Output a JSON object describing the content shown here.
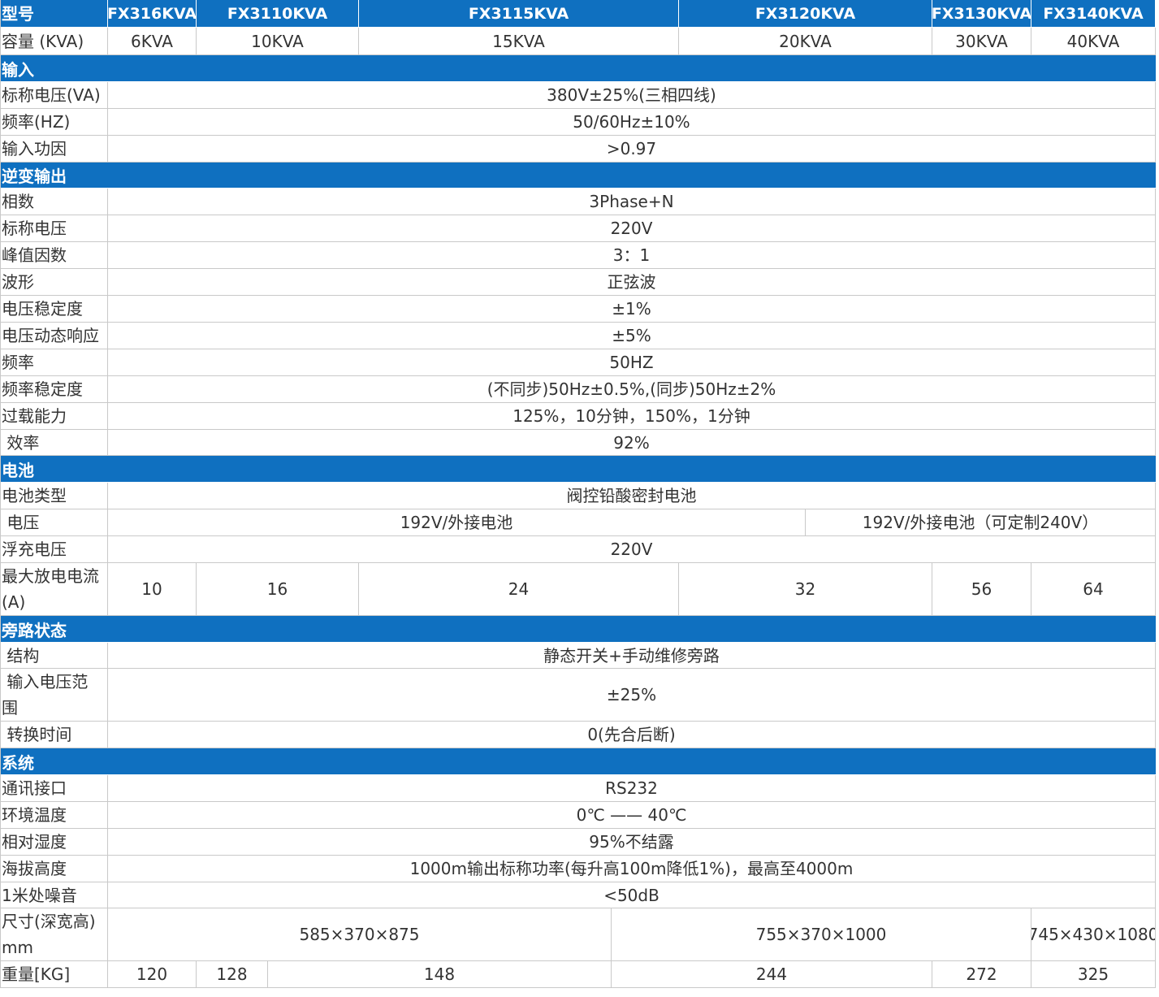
{
  "header": {
    "model_label": "型号",
    "models": [
      "FX316KVA",
      "FX3110KVA",
      "FX3115KVA",
      "FX3120KVA",
      "FX3130KVA",
      "FX3140KVA"
    ],
    "capacity_label": "容量 (KVA)",
    "capacities": [
      "6KVA",
      "10KVA",
      "15KVA",
      "20KVA",
      "30KVA",
      "40KVA"
    ]
  },
  "input": {
    "title": "输入",
    "voltage_label": "标称电压(VA)",
    "voltage": "380V±25%(三相四线)",
    "freq_label": "频率(HZ)",
    "freq": "50/60Hz±10%",
    "pf_label": "输入功因",
    "pf": ">0.97"
  },
  "output": {
    "title": "逆变输出",
    "phase_label": "相数",
    "phase": "3Phase+N",
    "voltage_label": "标称电压",
    "voltage": "220V",
    "crest_label": "峰值因数",
    "crest": "3：1",
    "wave_label": "波形",
    "wave": "正弦波",
    "stab_label": "电压稳定度",
    "stab": "±1%",
    "dyn_label": "电压动态响应",
    "dyn": "±5%",
    "freq_label": "频率",
    "freq": "50HZ",
    "fstab_label": "频率稳定度",
    "fstab": "(不同步)50Hz±0.5%,(同步)50Hz±2%",
    "overload_label": "过载能力",
    "overload": "125%，10分钟，150%，1分钟",
    "eff_label": " 效率",
    "eff": "92%"
  },
  "battery": {
    "title": "电池",
    "type_label": "电池类型",
    "type": "阀控铅酸密封电池",
    "voltage_label": " 电压",
    "voltage_a": "192V/外接电池",
    "voltage_b": "192V/外接电池（可定制240V）",
    "float_label": "浮充电压",
    "float": "220V",
    "current_label_1": "最大放电电流",
    "current_label_2": "(A)",
    "currents": [
      "10",
      "16",
      "24",
      "32",
      "56",
      "64"
    ]
  },
  "bypass": {
    "title": "旁路状态",
    "struct_label": " 结构",
    "struct": "静态开关+手动维修旁路",
    "range_label_1": " 输入电压范",
    "range_label_2": "围",
    "range": "±25%",
    "time_label": " 转换时间",
    "time": "0(先合后断)"
  },
  "system": {
    "title": "系统",
    "comm_label": "通讯接口",
    "comm": "RS232",
    "temp_label": "环境温度",
    "temp": "0℃ —— 40℃",
    "hum_label": "相对湿度",
    "hum": "95%不结露",
    "alt_label": "海拔高度",
    "alt": "1000m输出标称功率(每升高100m降低1%)，最高至4000m",
    "noise_label": "1米处噪音",
    "noise": "<50dB",
    "dim_label_1": "尺寸(深宽高)",
    "dim_label_2": "mm",
    "dims": [
      "585×370×875",
      "755×370×1000",
      "745×430×1080"
    ],
    "weight_label": "重量[KG]",
    "weights": [
      "120",
      "128",
      "148",
      "244",
      "272",
      "325"
    ]
  }
}
